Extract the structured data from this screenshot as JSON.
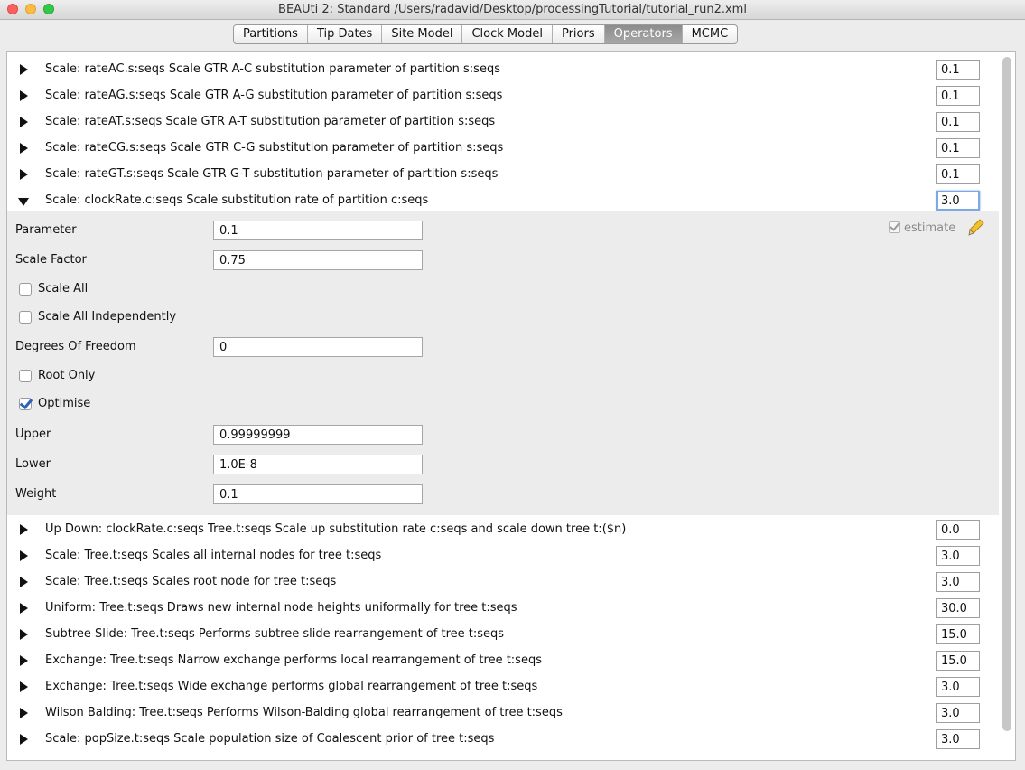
{
  "window": {
    "title": "BEAUti 2: Standard /Users/radavid/Desktop/processingTutorial/tutorial_run2.xml"
  },
  "tabs": [
    {
      "label": "Partitions"
    },
    {
      "label": "Tip Dates"
    },
    {
      "label": "Site Model"
    },
    {
      "label": "Clock Model"
    },
    {
      "label": "Priors"
    },
    {
      "label": "Operators",
      "active": true
    },
    {
      "label": "MCMC"
    }
  ],
  "operators_top": [
    {
      "label": "Scale: rateAC.s:seqs  Scale GTR A-C substitution parameter of partition s:seqs",
      "weight": "0.1"
    },
    {
      "label": "Scale: rateAG.s:seqs  Scale GTR A-G substitution parameter of partition s:seqs",
      "weight": "0.1"
    },
    {
      "label": "Scale: rateAT.s:seqs  Scale GTR A-T substitution parameter of partition s:seqs",
      "weight": "0.1"
    },
    {
      "label": "Scale: rateCG.s:seqs  Scale GTR C-G substitution parameter of partition s:seqs",
      "weight": "0.1"
    },
    {
      "label": "Scale: rateGT.s:seqs  Scale GTR G-T substitution parameter of partition s:seqs",
      "weight": "0.1"
    },
    {
      "label": "Scale: clockRate.c:seqs  Scale substitution rate of partition c:seqs",
      "weight": "3.0",
      "expanded": true
    }
  ],
  "details": {
    "parameter_label": "Parameter",
    "parameter_value": "0.1",
    "estimate_label": "estimate",
    "scale_factor_label": "Scale Factor",
    "scale_factor_value": "0.75",
    "scale_all_label": "Scale All",
    "scale_all_checked": false,
    "scale_all_independently_label": "Scale All Independently",
    "scale_all_independently_checked": false,
    "degrees_of_freedom_label": "Degrees Of Freedom",
    "degrees_of_freedom_value": "0",
    "root_only_label": "Root Only",
    "root_only_checked": false,
    "optimise_label": "Optimise",
    "optimise_checked": true,
    "upper_label": "Upper",
    "upper_value": "0.99999999",
    "lower_label": "Lower",
    "lower_value": "1.0E-8",
    "weight_label": "Weight",
    "weight_value": "0.1"
  },
  "operators_bottom": [
    {
      "label": "Up Down: clockRate.c:seqs Tree.t:seqs  Scale up substitution rate c:seqs and scale down tree t:($n)",
      "weight": "0.0"
    },
    {
      "label": "Scale: Tree.t:seqs  Scales all internal nodes for tree t:seqs",
      "weight": "3.0"
    },
    {
      "label": "Scale: Tree.t:seqs  Scales root node for tree t:seqs",
      "weight": "3.0"
    },
    {
      "label": "Uniform: Tree.t:seqs  Draws new internal node heights uniformally for tree t:seqs",
      "weight": "30.0"
    },
    {
      "label": "Subtree Slide: Tree.t:seqs  Performs subtree slide rearrangement of tree t:seqs",
      "weight": "15.0"
    },
    {
      "label": "Exchange: Tree.t:seqs  Narrow exchange performs local rearrangement of tree t:seqs",
      "weight": "15.0"
    },
    {
      "label": "Exchange: Tree.t:seqs  Wide exchange performs global rearrangement of tree t:seqs",
      "weight": "3.0"
    },
    {
      "label": "Wilson Balding: Tree.t:seqs  Performs Wilson-Balding global rearrangement of tree t:seqs",
      "weight": "3.0"
    },
    {
      "label": "Scale: popSize.t:seqs  Scale population size of Coalescent prior of tree t:seqs",
      "weight": "3.0"
    }
  ]
}
